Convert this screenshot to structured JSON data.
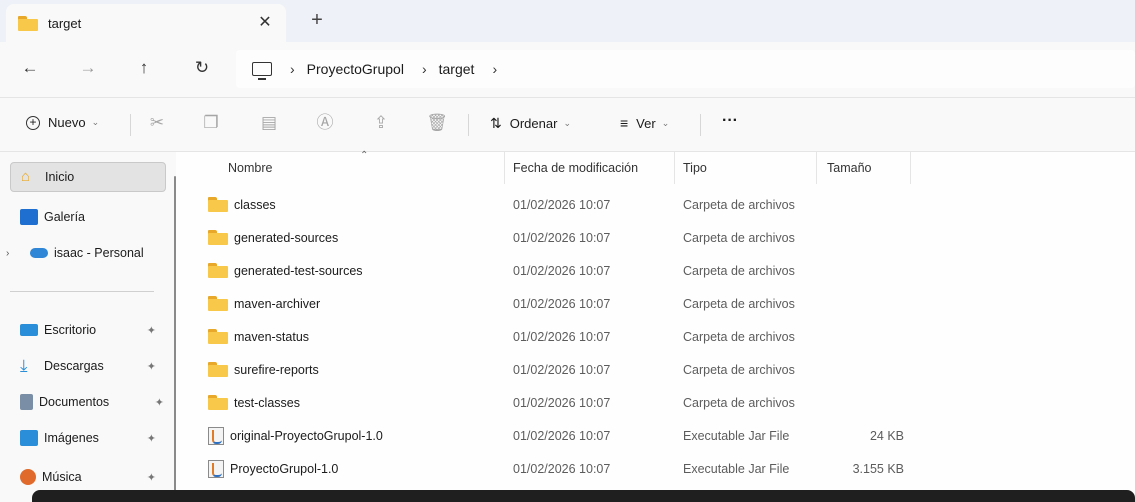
{
  "tab": {
    "title": "target",
    "close": "✕",
    "new_tab": "+"
  },
  "nav": {
    "back": "←",
    "forward": "→",
    "up": "↑",
    "refresh": "↻"
  },
  "address": {
    "separator": "›",
    "crumbs": [
      "ProyectoGrupol",
      "target"
    ]
  },
  "commandbar": {
    "new_label": "Nuevo",
    "sort_label": "Ordenar",
    "view_label": "Ver",
    "more": "···",
    "chevron": "⌄"
  },
  "sidebar": {
    "items": [
      {
        "label": "Inicio",
        "icon": "home-icon"
      },
      {
        "label": "Galería",
        "icon": "gallery-icon"
      },
      {
        "label": "isaac - Personal",
        "icon": "onedrive-icon"
      },
      {
        "label": "Escritorio",
        "icon": "desktop-icon",
        "pin": "📌"
      },
      {
        "label": "Descargas",
        "icon": "download-icon",
        "pin": "📌"
      },
      {
        "label": "Documentos",
        "icon": "documents-icon",
        "pin": "📌"
      },
      {
        "label": "Imágenes",
        "icon": "pictures-icon",
        "pin": "📌"
      },
      {
        "label": "Música",
        "icon": "music-icon",
        "pin": "📌"
      }
    ]
  },
  "columns": {
    "name": "Nombre",
    "date": "Fecha de modificación",
    "type": "Tipo",
    "size": "Tamaño"
  },
  "files": [
    {
      "name": "classes",
      "date": "01/02/2026 10:07",
      "type": "Carpeta de archivos",
      "size": "",
      "kind": "folder"
    },
    {
      "name": "generated-sources",
      "date": "01/02/2026 10:07",
      "type": "Carpeta de archivos",
      "size": "",
      "kind": "folder"
    },
    {
      "name": "generated-test-sources",
      "date": "01/02/2026 10:07",
      "type": "Carpeta de archivos",
      "size": "",
      "kind": "folder"
    },
    {
      "name": "maven-archiver",
      "date": "01/02/2026 10:07",
      "type": "Carpeta de archivos",
      "size": "",
      "kind": "folder"
    },
    {
      "name": "maven-status",
      "date": "01/02/2026 10:07",
      "type": "Carpeta de archivos",
      "size": "",
      "kind": "folder"
    },
    {
      "name": "surefire-reports",
      "date": "01/02/2026 10:07",
      "type": "Carpeta de archivos",
      "size": "",
      "kind": "folder"
    },
    {
      "name": "test-classes",
      "date": "01/02/2026 10:07",
      "type": "Carpeta de archivos",
      "size": "",
      "kind": "folder"
    },
    {
      "name": "original-ProyectoGrupol-1.0",
      "date": "01/02/2026 10:07",
      "type": "Executable Jar File",
      "size": "24 KB",
      "kind": "jar"
    },
    {
      "name": "ProyectoGrupol-1.0",
      "date": "01/02/2026 10:07",
      "type": "Executable Jar File",
      "size": "3.155 KB",
      "kind": "jar"
    }
  ]
}
